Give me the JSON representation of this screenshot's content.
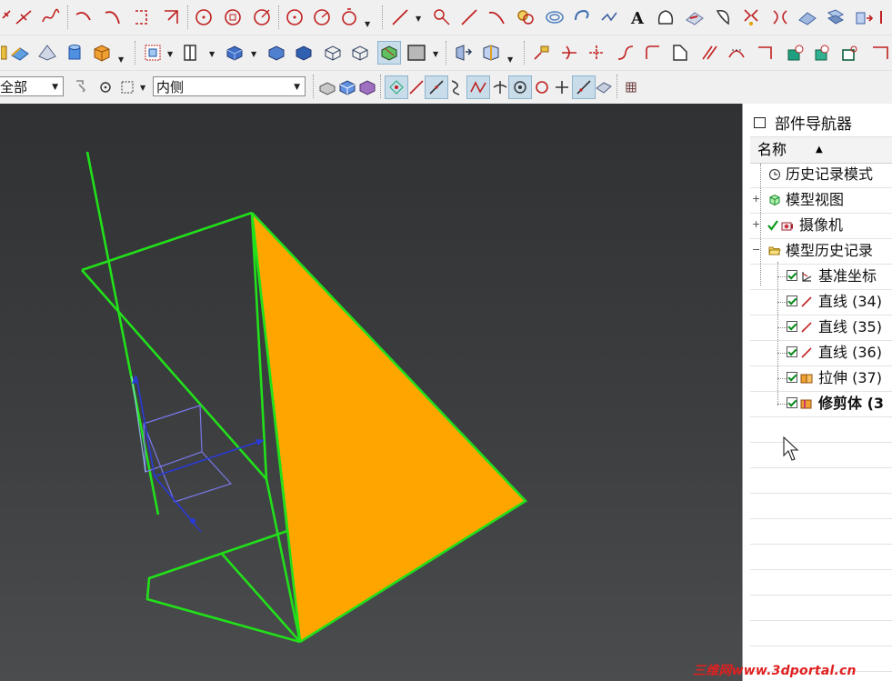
{
  "toolbar": {
    "filter_combo": "全部",
    "side_combo": "内侧"
  },
  "navigator": {
    "title": "部件导航器",
    "column_name": "名称",
    "items": [
      {
        "label": "历史记录模式",
        "icon": "history-clock-icon"
      },
      {
        "label": "模型视图",
        "icon": "model-views-icon"
      },
      {
        "label": "摄像机",
        "icon": "camera-icon"
      },
      {
        "label": "模型历史记录",
        "icon": "folder-open-icon"
      },
      {
        "label": "基准坐标",
        "icon": "datum-csys-icon"
      },
      {
        "label": "直线 (34)",
        "icon": "line-icon"
      },
      {
        "label": "直线 (35)",
        "icon": "line-icon"
      },
      {
        "label": "直线 (36)",
        "icon": "line-icon"
      },
      {
        "label": "拉伸 (37)",
        "icon": "extrude-icon"
      },
      {
        "label": "修剪体 (3",
        "icon": "trim-body-icon"
      }
    ]
  },
  "viewport": {
    "face_color": "#ffa500",
    "edge_color": "#22e01a"
  },
  "watermark": "三维网www.3dportal.cn"
}
